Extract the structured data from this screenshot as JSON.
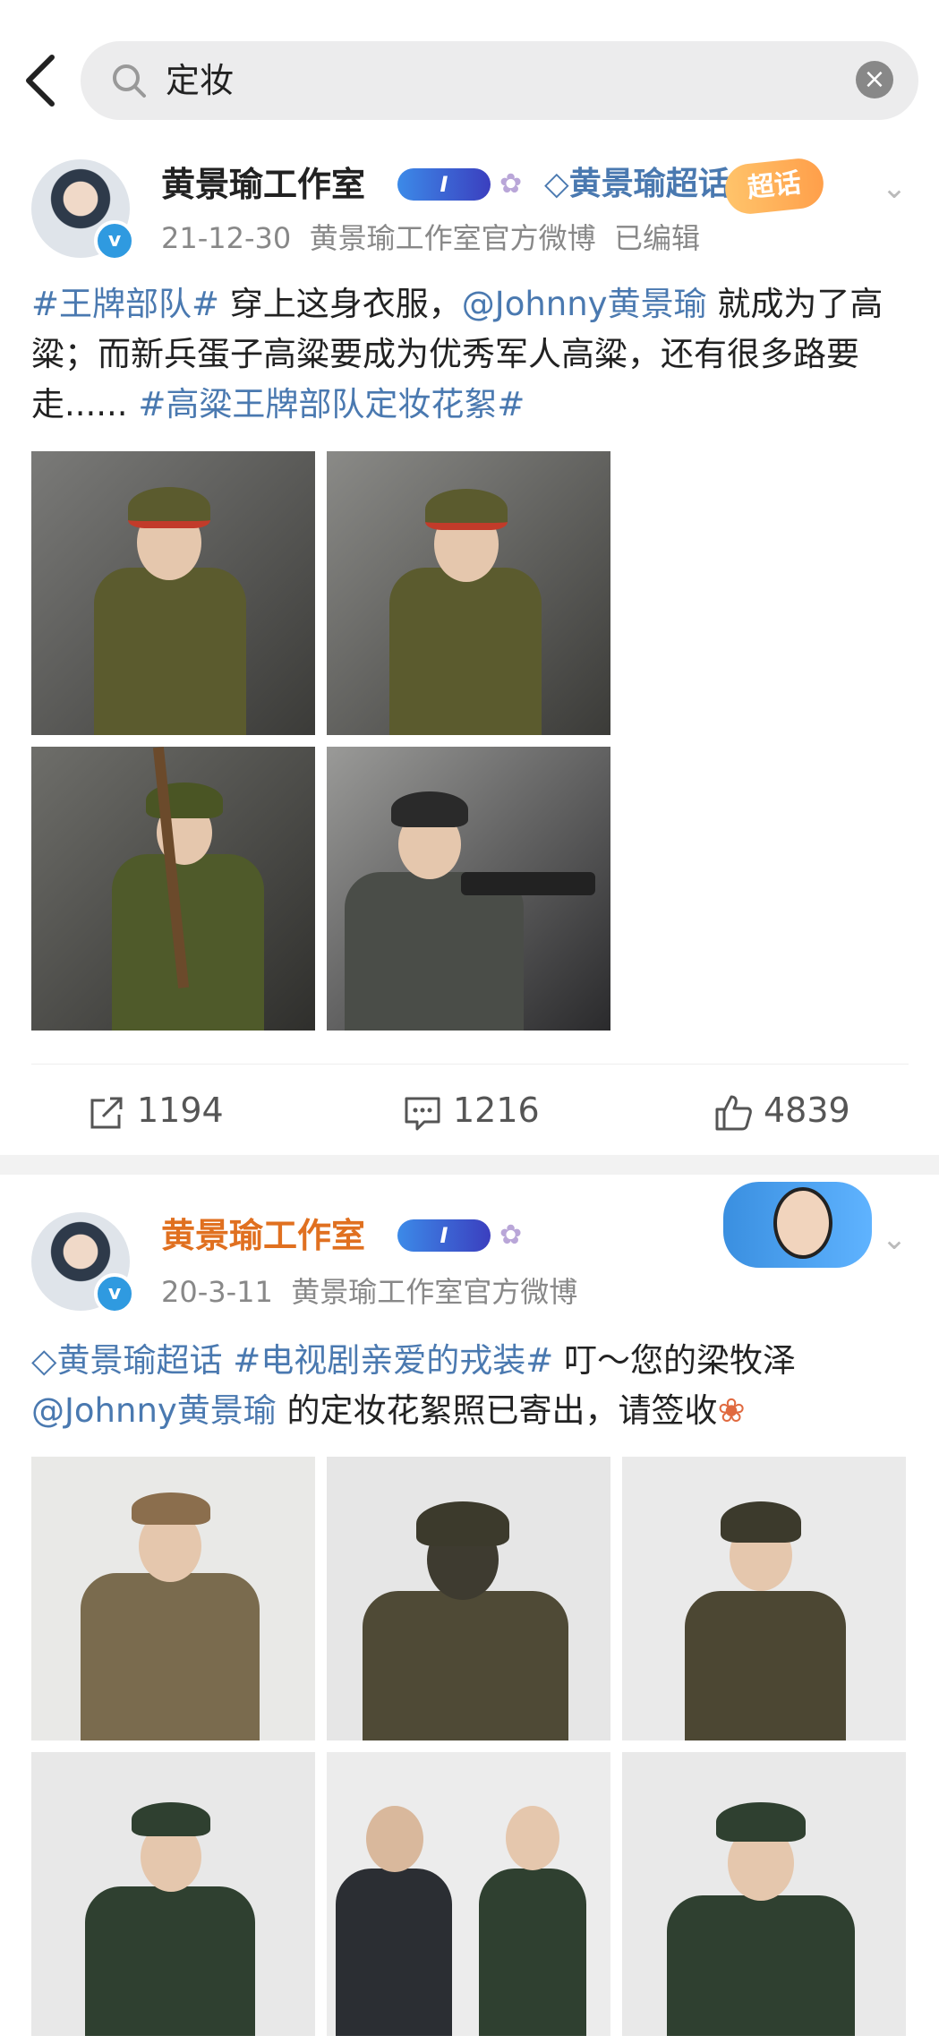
{
  "search": {
    "query": "定妆"
  },
  "posts": [
    {
      "username": "黄景瑜工作室",
      "vip_label": "I",
      "supertopic": "黄景瑜超话",
      "sticker": "超话",
      "date": "21-12-30",
      "source": "黄景瑜工作室官方微博",
      "edited": "已编辑",
      "content": {
        "tag1": "#王牌部队#",
        "text1": " 穿上这身衣服，",
        "mention": "@Johnny黄景瑜",
        "text2": " 就成为了高粱；而新兵蛋子高粱要成为优秀军人高粱，还有很多路要走......",
        "tag2": " #高粱王牌部队定妆花絮#"
      },
      "stats": {
        "repost": "1194",
        "comment": "1216",
        "like": "4839"
      }
    },
    {
      "username": "黄景瑜工作室",
      "vip_label": "I",
      "date": "20-3-11",
      "source": "黄景瑜工作室官方微博",
      "content": {
        "tag1": "黄景瑜超话",
        "tag2": " #电视剧亲爱的戎装#",
        "text1": " 叮～您的梁牧泽",
        "mention": "@Johnny黄景瑜",
        "text2": " 的定妆花絮照已寄出，请签收"
      }
    }
  ],
  "colors": {
    "link": "#4a79b0",
    "orange_name": "#e07020",
    "meta": "#888888"
  }
}
